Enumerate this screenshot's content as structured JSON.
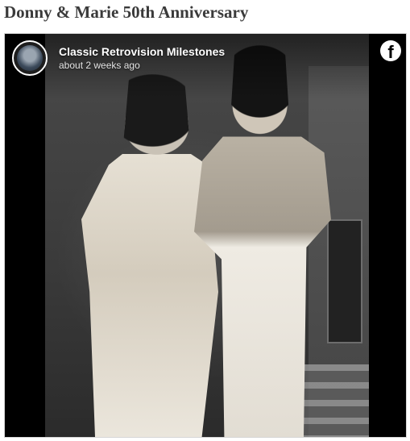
{
  "article": {
    "title": "Donny & Marie 50th Anniversary"
  },
  "embed": {
    "page_name": "Classic Retrovision Milestones",
    "timestamp": "about 2 weeks ago",
    "avatar_icon": "profile-avatar",
    "logo_icon": "facebook-icon",
    "logo_glyph": "f",
    "photo_description_icon": "photo"
  }
}
